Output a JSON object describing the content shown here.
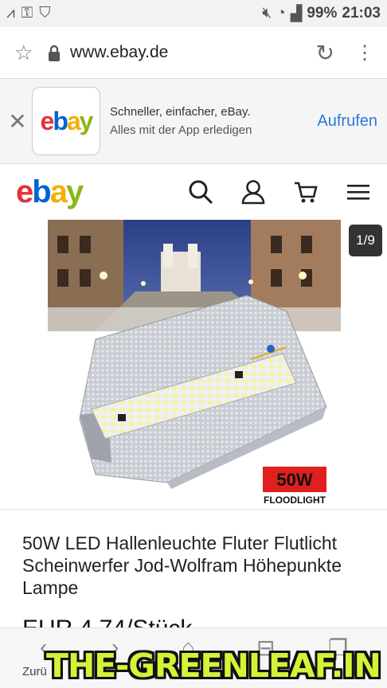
{
  "status_bar": {
    "left_icons": [
      "nfc-icon",
      "key-icon",
      "shield-alert-icon"
    ],
    "right_icons": [
      "mute-icon",
      "wifi-icon",
      "signal-icon"
    ],
    "battery": "99%",
    "time": "21:03"
  },
  "browser": {
    "url": "www.ebay.de",
    "back_label": "Zurü"
  },
  "app_banner": {
    "line1": "Schneller, einfacher, eBay.",
    "line2": "Alles mit der App erledigen",
    "open_label": "Aufrufen"
  },
  "header": {
    "logo": {
      "e": "e",
      "b": "b",
      "a": "a",
      "y": "y"
    }
  },
  "gallery": {
    "counter": "1/9",
    "badge": "50W",
    "caption": "FLOODLIGHT"
  },
  "product": {
    "title": "50W LED Hallenleuchte Fluter Flutlicht Scheinwerfer Jod-Wolfram Höhepunkte Lampe",
    "price": "EUR 4,74/Stück"
  },
  "watermark": "THE-GREENLEAF.IN",
  "colors": {
    "accent": "#2a7bd8",
    "badge_red": "#e0201e",
    "ebay_red": "#e53238",
    "ebay_blue": "#0064d2",
    "ebay_yellow": "#f5af02",
    "ebay_green": "#86b817"
  }
}
